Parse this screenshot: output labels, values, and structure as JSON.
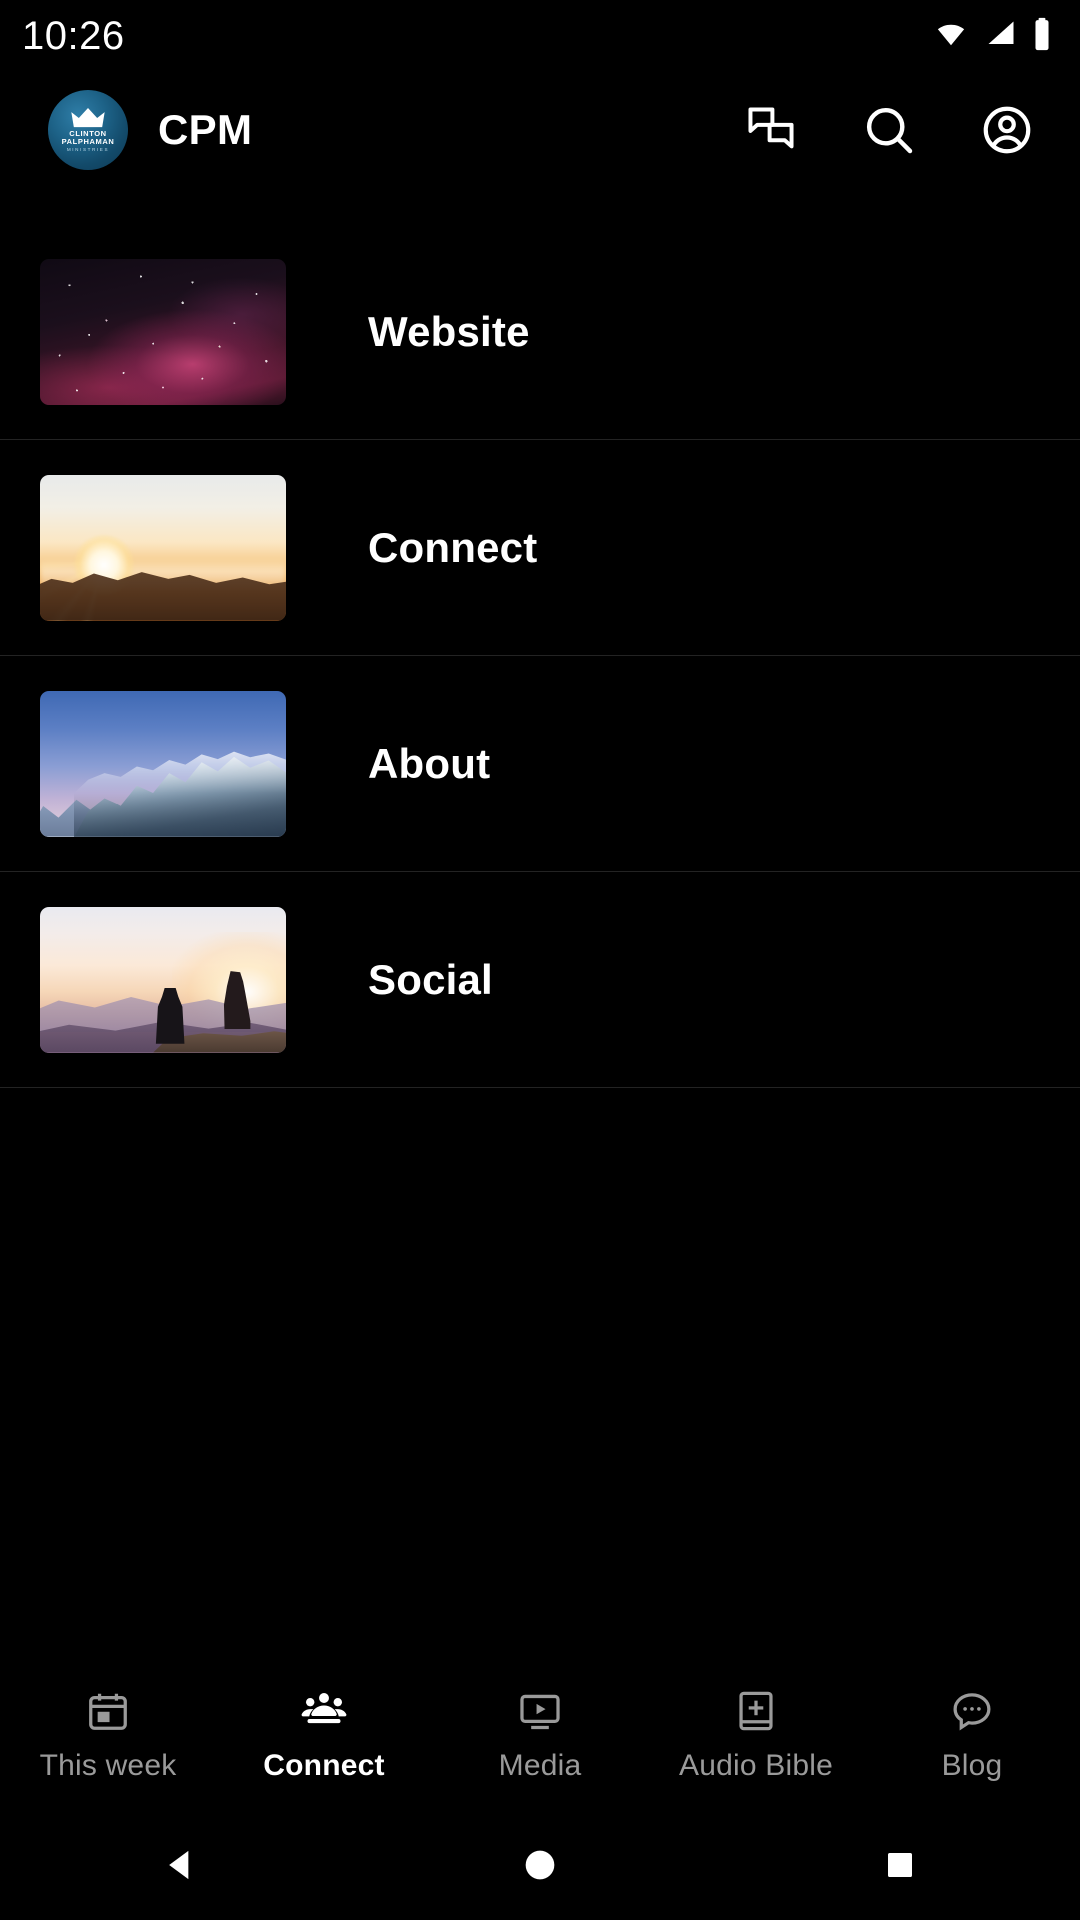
{
  "status_bar": {
    "time": "10:26",
    "icons": [
      "wifi-icon",
      "cellular-signal-icon",
      "battery-icon"
    ]
  },
  "app_bar": {
    "logo": {
      "icon": "church-logo-icon",
      "crown_line1": "CLINTON",
      "crown_line2": "PALPHAMAN",
      "crown_line3": "MINISTRIES",
      "background_color": "#1d6287"
    },
    "title": "CPM",
    "actions": [
      {
        "name": "chat-icon",
        "label": "Chat"
      },
      {
        "name": "search-icon",
        "label": "Search"
      },
      {
        "name": "account-icon",
        "label": "Account"
      }
    ]
  },
  "list": {
    "items": [
      {
        "label": "Website",
        "thumbnail": "starry-galaxy-night-sky"
      },
      {
        "label": "Connect",
        "thumbnail": "sunrise-over-mountain-clouds"
      },
      {
        "label": "About",
        "thumbnail": "snowy-mountain-peaks"
      },
      {
        "label": "Social",
        "thumbnail": "silhouettes-watching-sunset"
      }
    ]
  },
  "bottom_nav": {
    "active_index": 1,
    "items": [
      {
        "label": "This week",
        "icon": "calendar-icon",
        "active": false
      },
      {
        "label": "Connect",
        "icon": "people-group-icon",
        "active": true
      },
      {
        "label": "Media",
        "icon": "video-play-icon",
        "active": false
      },
      {
        "label": "Audio Bible",
        "icon": "book-plus-icon",
        "active": false
      },
      {
        "label": "Blog",
        "icon": "chat-bubble-dots-icon",
        "active": false
      }
    ],
    "active_color": "#ffffff",
    "inactive_color": "#9a9a9a"
  },
  "system_nav": {
    "buttons": [
      {
        "name": "back-button",
        "icon": "triangle-back-icon"
      },
      {
        "name": "home-button",
        "icon": "circle-home-icon"
      },
      {
        "name": "recents-button",
        "icon": "square-recents-icon"
      }
    ]
  },
  "theme": {
    "background": "#000000",
    "divider": "#232323",
    "text": "#ffffff"
  }
}
